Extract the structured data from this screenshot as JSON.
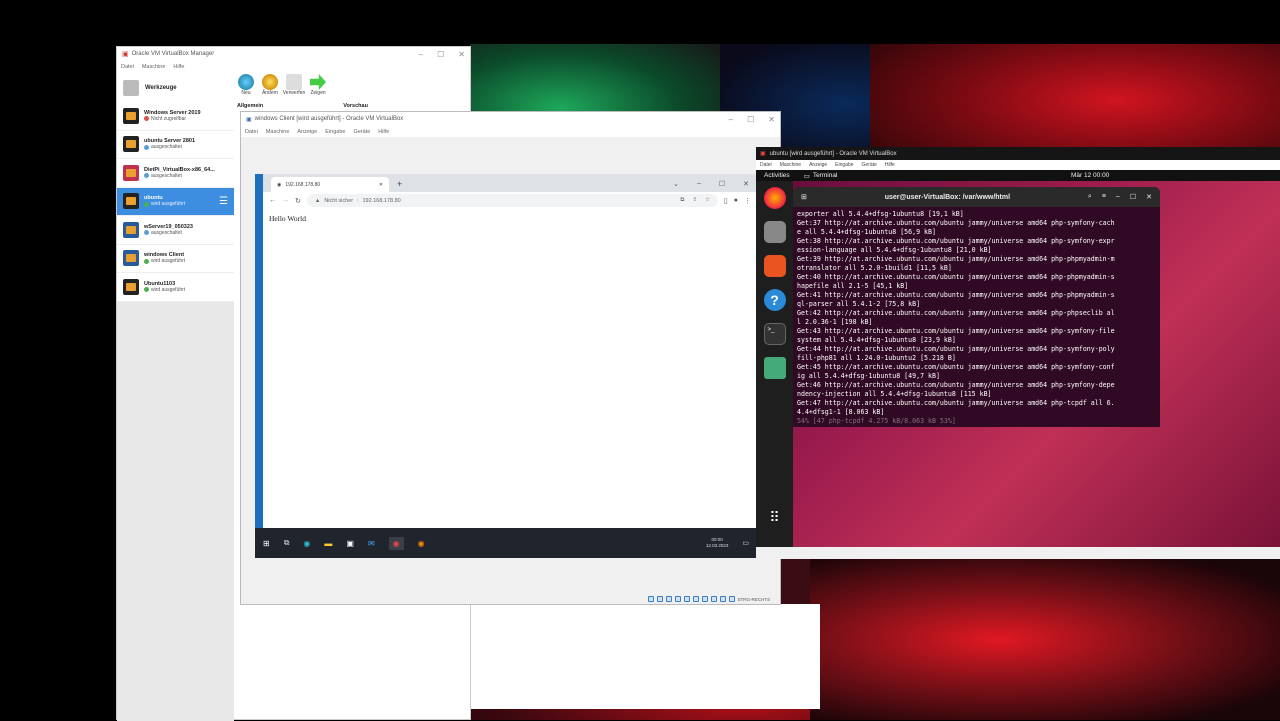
{
  "manager": {
    "title": "Oracle VM VirtualBox Manager",
    "menu": [
      "Datei",
      "Maschine",
      "Hilfe"
    ],
    "tools_label": "Werkzeuge",
    "toolbar": [
      "Neu",
      "Ändern",
      "Verwerfen",
      "Zeigen"
    ],
    "panel_general": "Allgemein",
    "panel_preview": "Vorschau",
    "vms": [
      {
        "name": "Windows Server 2019",
        "state": "Nicht zugreifbar",
        "color": "#d9534f"
      },
      {
        "name": "ubuntu Server 2801",
        "state": "ausgeschaltet",
        "color": "#5a9fd4"
      },
      {
        "name": "DietPi_VirtualBox-x86_64...",
        "state": "ausgeschaltet",
        "color": "#5a9fd4"
      },
      {
        "name": "ubuntu",
        "state": "wird ausgeführt",
        "color": "#4caf50",
        "selected": true
      },
      {
        "name": "wServer19_050323",
        "state": "ausgeschaltet",
        "color": "#5a9fd4"
      },
      {
        "name": "windows Client",
        "state": "wird ausgeführt",
        "color": "#4caf50"
      },
      {
        "name": "Ubuntu1103",
        "state": "wird ausgeführt",
        "color": "#4caf50"
      }
    ]
  },
  "win_client": {
    "title": "windows Client [wird ausgeführt] - Oracle VM VirtualBox",
    "menu": [
      "Datei",
      "Maschine",
      "Anzeige",
      "Eingabe",
      "Geräte",
      "Hilfe"
    ],
    "tab_title": "192.168.178.80",
    "security": "Nicht sicher",
    "url": "192.168.178.80",
    "page_text": "Hello World",
    "clock_time": "00:00",
    "clock_date": "12.03.2023",
    "status_key": "STRG-RECHTS"
  },
  "ubuntu": {
    "title": "ubuntu [wird ausgeführt] - Oracle VM VirtualBox",
    "menu": [
      "Datei",
      "Maschine",
      "Anzeige",
      "Eingabe",
      "Geräte",
      "Hilfe"
    ],
    "activities": "Activities",
    "app_name": "Terminal",
    "clock": "Mär 12  00:00",
    "terminal_title": "user@user-VirtualBox: /var/www/html",
    "terminal_lines": [
      "exporter all 5.4.4+dfsg-1ubuntu8 [19,1 kB]",
      "Get:37 http://at.archive.ubuntu.com/ubuntu jammy/universe amd64 php-symfony-cach",
      "e all 5.4.4+dfsg-1ubuntu8 [56,9 kB]",
      "Get:38 http://at.archive.ubuntu.com/ubuntu jammy/universe amd64 php-symfony-expr",
      "ession-language all 5.4.4+dfsg-1ubuntu8 [21,0 kB]",
      "Get:39 http://at.archive.ubuntu.com/ubuntu jammy/universe amd64 php-phpmyadmin-m",
      "otranslator all 5.2.0-1build1 [11,5 kB]",
      "Get:40 http://at.archive.ubuntu.com/ubuntu jammy/universe amd64 php-phpmyadmin-s",
      "hapefile all 2.1-5 [45,1 kB]",
      "Get:41 http://at.archive.ubuntu.com/ubuntu jammy/universe amd64 php-phpmyadmin-s",
      "ql-parser all 5.4.1-2 [75,8 kB]",
      "Get:42 http://at.archive.ubuntu.com/ubuntu jammy/universe amd64 php-phpseclib al",
      "l 2.0.36-1 [198 kB]",
      "Get:43 http://at.archive.ubuntu.com/ubuntu jammy/universe amd64 php-symfony-file",
      "system all 5.4.4+dfsg-1ubuntu8 [23,9 kB]",
      "Get:44 http://at.archive.ubuntu.com/ubuntu jammy/universe amd64 php-symfony-poly",
      "fill-php81 all 1.24.0-1ubuntu2 [5.218 B]",
      "Get:45 http://at.archive.ubuntu.com/ubuntu jammy/universe amd64 php-symfony-conf",
      "ig all 5.4.4+dfsg-1ubuntu8 [49,7 kB]",
      "Get:46 http://at.archive.ubuntu.com/ubuntu jammy/universe amd64 php-symfony-depe",
      "ndency-injection all 5.4.4+dfsg-1ubuntu8 [115 kB]",
      "Get:47 http://at.archive.ubuntu.com/ubuntu jammy/universe amd64 php-tcpdf all 6.",
      "4.4+dfsg1-1 [8.063 kB]"
    ],
    "progress_line": "54% [47 php-tcpdf 4.275 kB/8.063 kB 53%]"
  }
}
